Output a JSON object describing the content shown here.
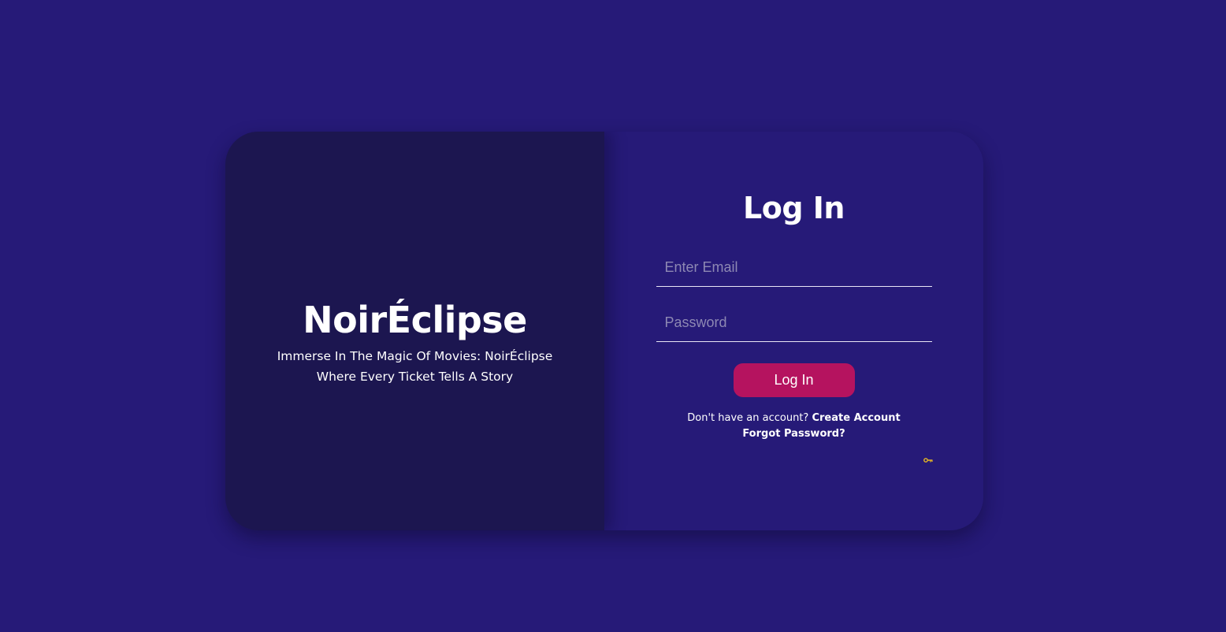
{
  "brand": {
    "name": "NoirÉclipse",
    "tagline_line1": "Immerse In The Magic Of Movies: NoirÉclipse",
    "tagline_line2": "Where Every Ticket Tells A Story"
  },
  "login": {
    "heading": "Log In",
    "email_placeholder": "Enter Email",
    "email_value": "",
    "password_placeholder": "Password",
    "password_value": "",
    "submit_label": "Log In",
    "no_account_text": "Don't have an account?",
    "create_account_label": "Create Account",
    "forgot_password_label": "Forgot Password?"
  },
  "icons": {
    "key": "key-icon"
  },
  "colors": {
    "background": "#261a78",
    "brand_panel": "#1c1650",
    "button": "#b5135f",
    "key_icon": "#e8b923"
  }
}
